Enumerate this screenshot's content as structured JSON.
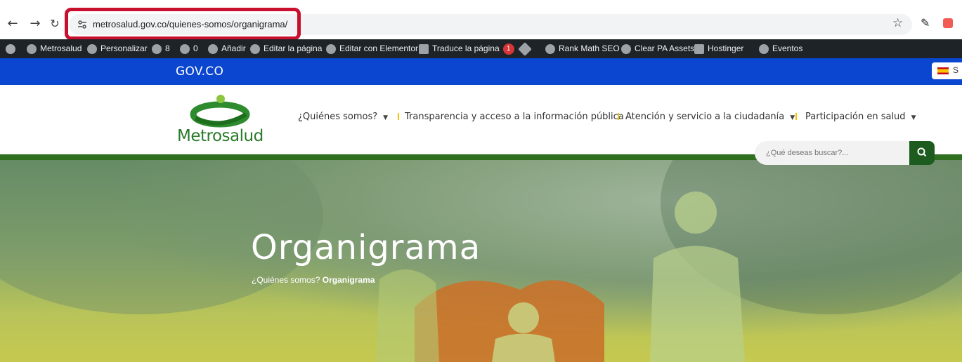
{
  "browser": {
    "url": "metrosalud.gov.co/quienes-somos/organigrama/"
  },
  "adminbar": {
    "items": [
      {
        "label": "Metrosalud"
      },
      {
        "label": "Personalizar"
      },
      {
        "label": "8"
      },
      {
        "label": "0"
      },
      {
        "label": "Añadir"
      },
      {
        "label": "Editar la página"
      },
      {
        "label": "Editar con Elementor"
      },
      {
        "label": "Traduce la página"
      },
      {
        "label": "Rank Math SEO"
      },
      {
        "label": "Clear PA Assets"
      },
      {
        "label": "Hostinger"
      },
      {
        "label": "Eventos"
      }
    ],
    "translate_badge": "1"
  },
  "govbar": {
    "logo": "GOV.CO",
    "lang": "S"
  },
  "header": {
    "logo_text": "Metrosalud",
    "menu": [
      {
        "label": "¿Quiénes somos?",
        "has_dropdown": true
      },
      {
        "label": "Transparencia y acceso a la información pública",
        "has_dropdown": false
      },
      {
        "label": "Atención y servicio a la ciudadanía",
        "has_dropdown": true
      },
      {
        "label": "Participación en salud",
        "has_dropdown": true
      }
    ],
    "search_placeholder": "¿Qué deseas buscar?..."
  },
  "hero": {
    "title": "Organigrama",
    "breadcrumb_parent": "¿Quiénes somos?",
    "breadcrumb_current": "Organigrama"
  },
  "colors": {
    "gov_blue": "#0b46d1",
    "brand_green": "#2f6f1f",
    "highlight_red": "#c8102e"
  }
}
